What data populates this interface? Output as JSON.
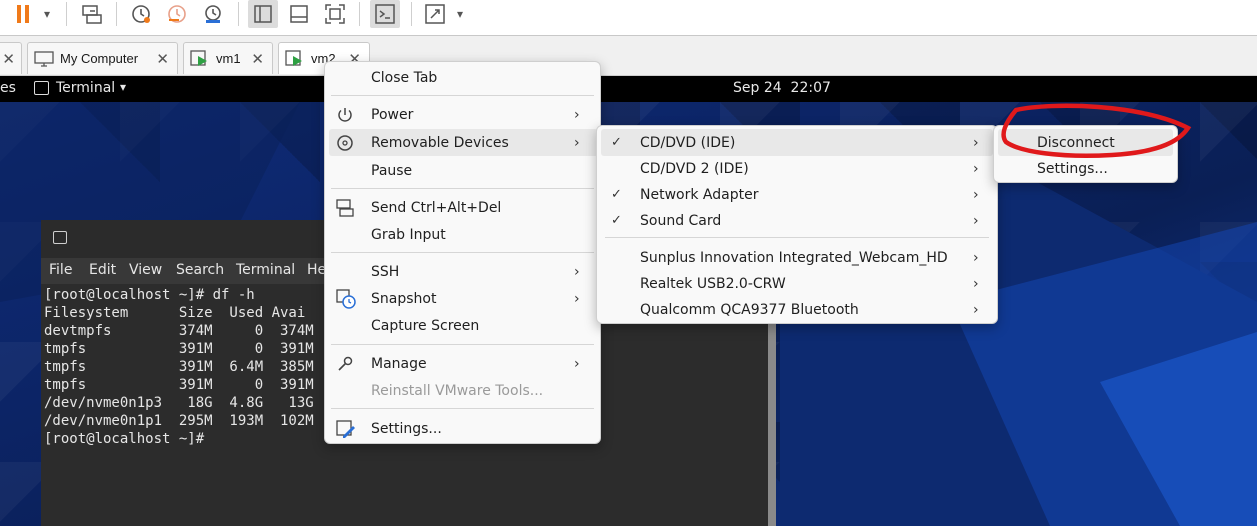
{
  "toolbar": {
    "items": [
      "pause-icon",
      "dropdown-arrow-icon",
      "send-ctrl-alt-del-icon",
      "snapshot-icon",
      "revert-snapshot-icon",
      "manage-snapshots-icon",
      "show-library-icon",
      "thumbnail-bar-icon",
      "full-screen-icon",
      "console-view-icon",
      "stretch-icon",
      "dropdown-arrow-icon"
    ],
    "accent_orange": "#f07a1a"
  },
  "tabs": [
    {
      "label": "My Computer",
      "icon": "computer-icon",
      "close": "✕"
    },
    {
      "label": "vm1",
      "icon": "vm-running-icon",
      "close": "✕"
    },
    {
      "label": "vm2",
      "icon": "vm-running-icon",
      "close": "✕"
    }
  ],
  "gnome_bar": {
    "activities": "es",
    "app_menu": "Terminal",
    "clock": "Sep 24  22:07"
  },
  "terminal": {
    "menu": [
      "File",
      "Edit",
      "View",
      "Search",
      "Terminal",
      "He"
    ],
    "lines": [
      "[root@localhost ~]# df -h",
      "Filesystem      Size  Used Avai",
      "devtmpfs        374M     0  374M",
      "tmpfs           391M     0  391M",
      "tmpfs           391M  6.4M  385M",
      "tmpfs           391M     0  391M",
      "/dev/nvme0n1p3   18G  4.8G   13G",
      "/dev/nvme0n1p1  295M  193M  102M",
      "[root@localhost ~]#"
    ]
  },
  "menu_main": {
    "items": [
      {
        "label": "Close Tab",
        "icon": "",
        "submenu": false,
        "enabled": true
      },
      {
        "label": "Power",
        "icon": "power-icon",
        "submenu": true,
        "enabled": true
      },
      {
        "label": "Removable Devices",
        "icon": "disc-icon",
        "submenu": true,
        "enabled": true
      },
      {
        "label": "Pause",
        "icon": "",
        "submenu": false,
        "enabled": true
      },
      {
        "label": "Send Ctrl+Alt+Del",
        "icon": "send-keys-icon",
        "submenu": false,
        "enabled": true
      },
      {
        "label": "Grab Input",
        "icon": "",
        "submenu": false,
        "enabled": true
      },
      {
        "label": "SSH",
        "icon": "",
        "submenu": true,
        "enabled": true
      },
      {
        "label": "Snapshot",
        "icon": "snapshot-icon",
        "submenu": true,
        "enabled": true
      },
      {
        "label": "Capture Screen",
        "icon": "",
        "submenu": false,
        "enabled": true
      },
      {
        "label": "Manage",
        "icon": "wrench-icon",
        "submenu": true,
        "enabled": true
      },
      {
        "label": "Reinstall VMware Tools...",
        "icon": "",
        "submenu": false,
        "enabled": false
      },
      {
        "label": "Settings...",
        "icon": "settings-icon",
        "submenu": false,
        "enabled": true
      }
    ],
    "highlighted": "Removable Devices"
  },
  "menu_devices": {
    "items": [
      {
        "label": "CD/DVD (IDE)",
        "checked": true,
        "submenu": true
      },
      {
        "label": "CD/DVD 2 (IDE)",
        "checked": false,
        "submenu": true
      },
      {
        "label": "Network Adapter",
        "checked": true,
        "submenu": true
      },
      {
        "label": "Sound Card",
        "checked": true,
        "submenu": true
      },
      {
        "label": "Sunplus Innovation Integrated_Webcam_HD",
        "checked": false,
        "submenu": true
      },
      {
        "label": "Realtek USB2.0-CRW",
        "checked": false,
        "submenu": true
      },
      {
        "label": "Qualcomm QCA9377 Bluetooth",
        "checked": false,
        "submenu": true
      }
    ],
    "highlighted": "CD/DVD (IDE)"
  },
  "menu_cd": {
    "items": [
      {
        "label": "Disconnect"
      },
      {
        "label": "Settings..."
      }
    ],
    "highlighted": "Disconnect",
    "annotation_color": "#e0191b"
  },
  "glyphs": {
    "submenu_arrow": "›",
    "check": "✓",
    "dropdown": "▾"
  }
}
